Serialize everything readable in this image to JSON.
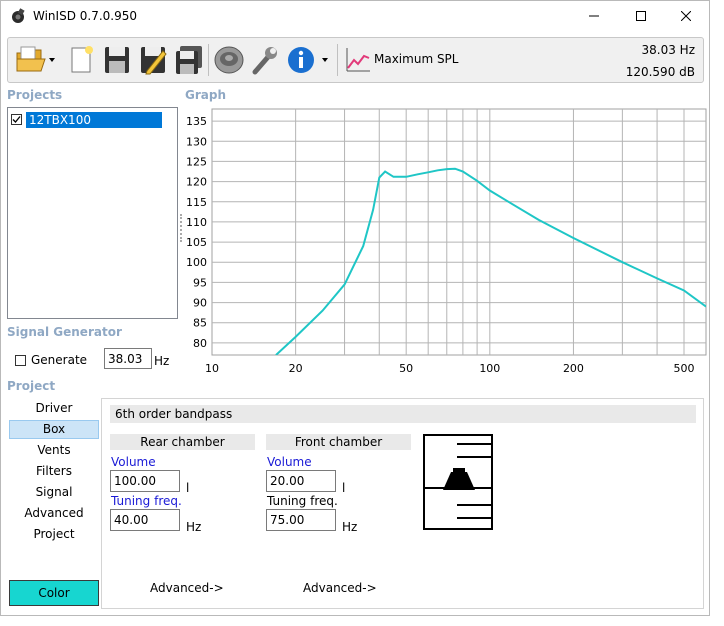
{
  "window": {
    "title": "WinISD 0.7.0.950"
  },
  "toolbar": {
    "mode_label": "Maximum SPL",
    "readout_freq": "38.03 Hz",
    "readout_spl": "120.590 dB"
  },
  "sections": {
    "projects": "Projects",
    "graph": "Graph",
    "signal_generator": "Signal Generator",
    "project": "Project"
  },
  "projects": {
    "items": [
      {
        "label": "12TBX100",
        "checked": true
      }
    ]
  },
  "signal_generator": {
    "generate_label": "Generate",
    "generate_checked": false,
    "frequency": "38.03",
    "unit": "Hz"
  },
  "nav": {
    "items": [
      "Driver",
      "Box",
      "Vents",
      "Filters",
      "Signal",
      "Advanced",
      "Project"
    ],
    "active": "Box",
    "color_button": "Color"
  },
  "box": {
    "type": "6th order bandpass",
    "rear": {
      "header": "Rear chamber",
      "volume_label": "Volume",
      "volume": "100.00",
      "volume_unit": "l",
      "tuning_label": "Tuning freq.",
      "tuning": "40.00",
      "tuning_unit": "Hz",
      "advanced": "Advanced->"
    },
    "front": {
      "header": "Front chamber",
      "volume_label": "Volume",
      "volume": "20.00",
      "volume_unit": "l",
      "tuning_label": "Tuning freq.",
      "tuning": "75.00",
      "tuning_unit": "Hz",
      "advanced": "Advanced->"
    }
  },
  "colors": {
    "curve": "#1fc6c6",
    "selection": "#0078d7",
    "section_label": "#8fa8c4",
    "color_button": "#17d6d0"
  },
  "chart_data": {
    "type": "line",
    "xscale": "log",
    "xlim": [
      10,
      600
    ],
    "ylim": [
      77,
      138
    ],
    "grid": true,
    "x_ticks": [
      10,
      20,
      50,
      100,
      200,
      500
    ],
    "y_ticks": [
      80,
      85,
      90,
      95,
      100,
      105,
      110,
      115,
      120,
      125,
      130,
      135
    ],
    "series": [
      {
        "x": [
          17,
          20,
          25,
          30,
          35,
          38,
          40,
          42,
          45,
          50,
          55,
          60,
          65,
          70,
          75,
          80,
          90,
          100,
          120,
          150,
          200,
          300,
          400,
          500,
          600
        ],
        "y": [
          77,
          81.5,
          88,
          94.5,
          104,
          113,
          121,
          122.5,
          121.2,
          121.2,
          121.8,
          122.3,
          122.8,
          123.1,
          123.2,
          122.5,
          120.2,
          117.8,
          114.5,
          110.5,
          106,
          100,
          96,
          93,
          89
        ]
      }
    ]
  }
}
